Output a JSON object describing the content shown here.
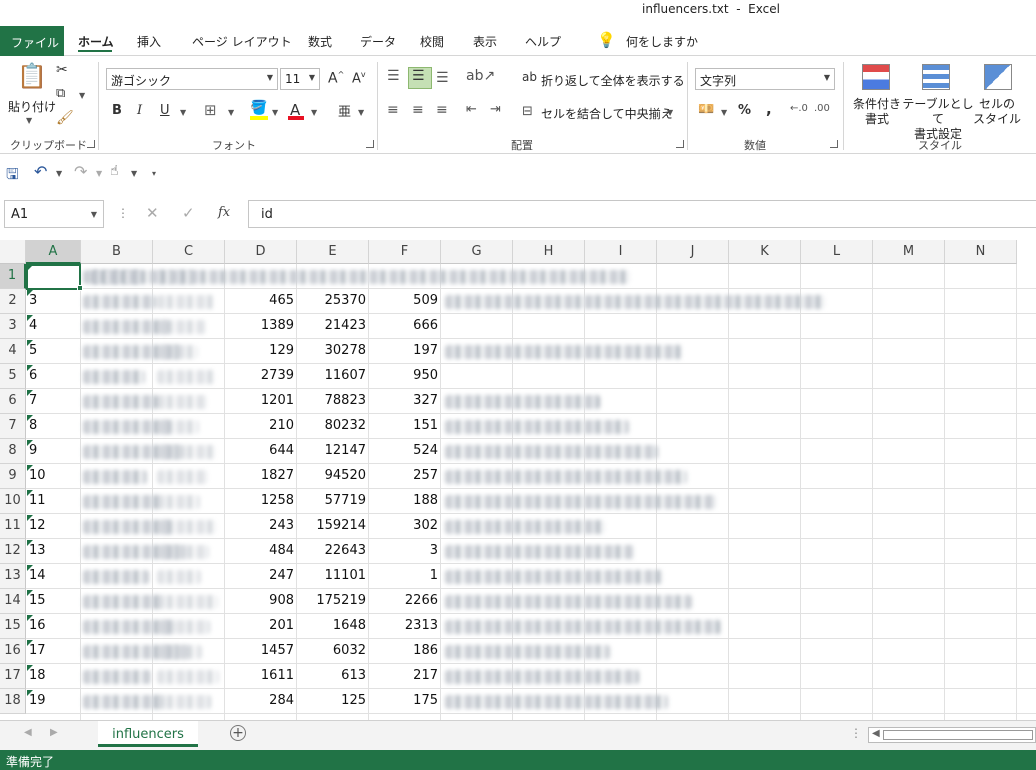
{
  "window": {
    "title": "influencers.txt  -  Excel"
  },
  "tabs": [
    {
      "label": "ファイル"
    },
    {
      "label": "ホーム"
    },
    {
      "label": "挿入"
    },
    {
      "label": "ページ レイアウト"
    },
    {
      "label": "数式"
    },
    {
      "label": "データ"
    },
    {
      "label": "校閲"
    },
    {
      "label": "表示"
    },
    {
      "label": "ヘルプ"
    }
  ],
  "tell_me": "何をしますか",
  "ribbon": {
    "clipboard": {
      "paste_label": "貼り付け",
      "group_label": "クリップボード"
    },
    "font": {
      "name": "游ゴシック",
      "size": "11",
      "bold": "B",
      "italic": "I",
      "underline": "U",
      "group_label": "フォント"
    },
    "alignment": {
      "wrap_text": "折り返して全体を表示する",
      "merge_center": "セルを結合して中央揃え",
      "group_label": "配置"
    },
    "number": {
      "format": "文字列",
      "percent": "%",
      "comma": ",",
      "group_label": "数値"
    },
    "styles": {
      "conditional": "条件付き\n書式",
      "table": "テーブルとして\n書式設定",
      "cell_styles": "セルの\nスタイル",
      "group_label": "スタイル"
    }
  },
  "formula_bar": {
    "name_box": "A1",
    "fx": "fx",
    "value": "id"
  },
  "columns": [
    "A",
    "B",
    "C",
    "D",
    "E",
    "F",
    "G",
    "H",
    "I",
    "J",
    "K",
    "L",
    "M",
    "N"
  ],
  "rows": [
    {
      "num": "1",
      "a": "",
      "d": "",
      "e": "",
      "f": ""
    },
    {
      "num": "2",
      "a": "3",
      "d": "465",
      "e": "25370",
      "f": "509"
    },
    {
      "num": "3",
      "a": "4",
      "d": "1389",
      "e": "21423",
      "f": "666"
    },
    {
      "num": "4",
      "a": "5",
      "d": "129",
      "e": "30278",
      "f": "197"
    },
    {
      "num": "5",
      "a": "6",
      "d": "2739",
      "e": "11607",
      "f": "950"
    },
    {
      "num": "6",
      "a": "7",
      "d": "1201",
      "e": "78823",
      "f": "327"
    },
    {
      "num": "7",
      "a": "8",
      "d": "210",
      "e": "80232",
      "f": "151"
    },
    {
      "num": "8",
      "a": "9",
      "d": "644",
      "e": "12147",
      "f": "524"
    },
    {
      "num": "9",
      "a": "10",
      "d": "1827",
      "e": "94520",
      "f": "257"
    },
    {
      "num": "10",
      "a": "11",
      "d": "1258",
      "e": "57719",
      "f": "188"
    },
    {
      "num": "11",
      "a": "12",
      "d": "243",
      "e": "159214",
      "f": "302"
    },
    {
      "num": "12",
      "a": "13",
      "d": "484",
      "e": "22643",
      "f": "3"
    },
    {
      "num": "13",
      "a": "14",
      "d": "247",
      "e": "11101",
      "f": "1"
    },
    {
      "num": "14",
      "a": "15",
      "d": "908",
      "e": "175219",
      "f": "2266"
    },
    {
      "num": "15",
      "a": "16",
      "d": "201",
      "e": "1648",
      "f": "2313"
    },
    {
      "num": "16",
      "a": "17",
      "d": "1457",
      "e": "6032",
      "f": "186"
    },
    {
      "num": "17",
      "a": "18",
      "d": "1611",
      "e": "613",
      "f": "217"
    },
    {
      "num": "18",
      "a": "19",
      "d": "284",
      "e": "125",
      "f": "175"
    }
  ],
  "sheet_tab": "influencers",
  "status": "準備完了",
  "colors": {
    "accent": "#217346"
  }
}
